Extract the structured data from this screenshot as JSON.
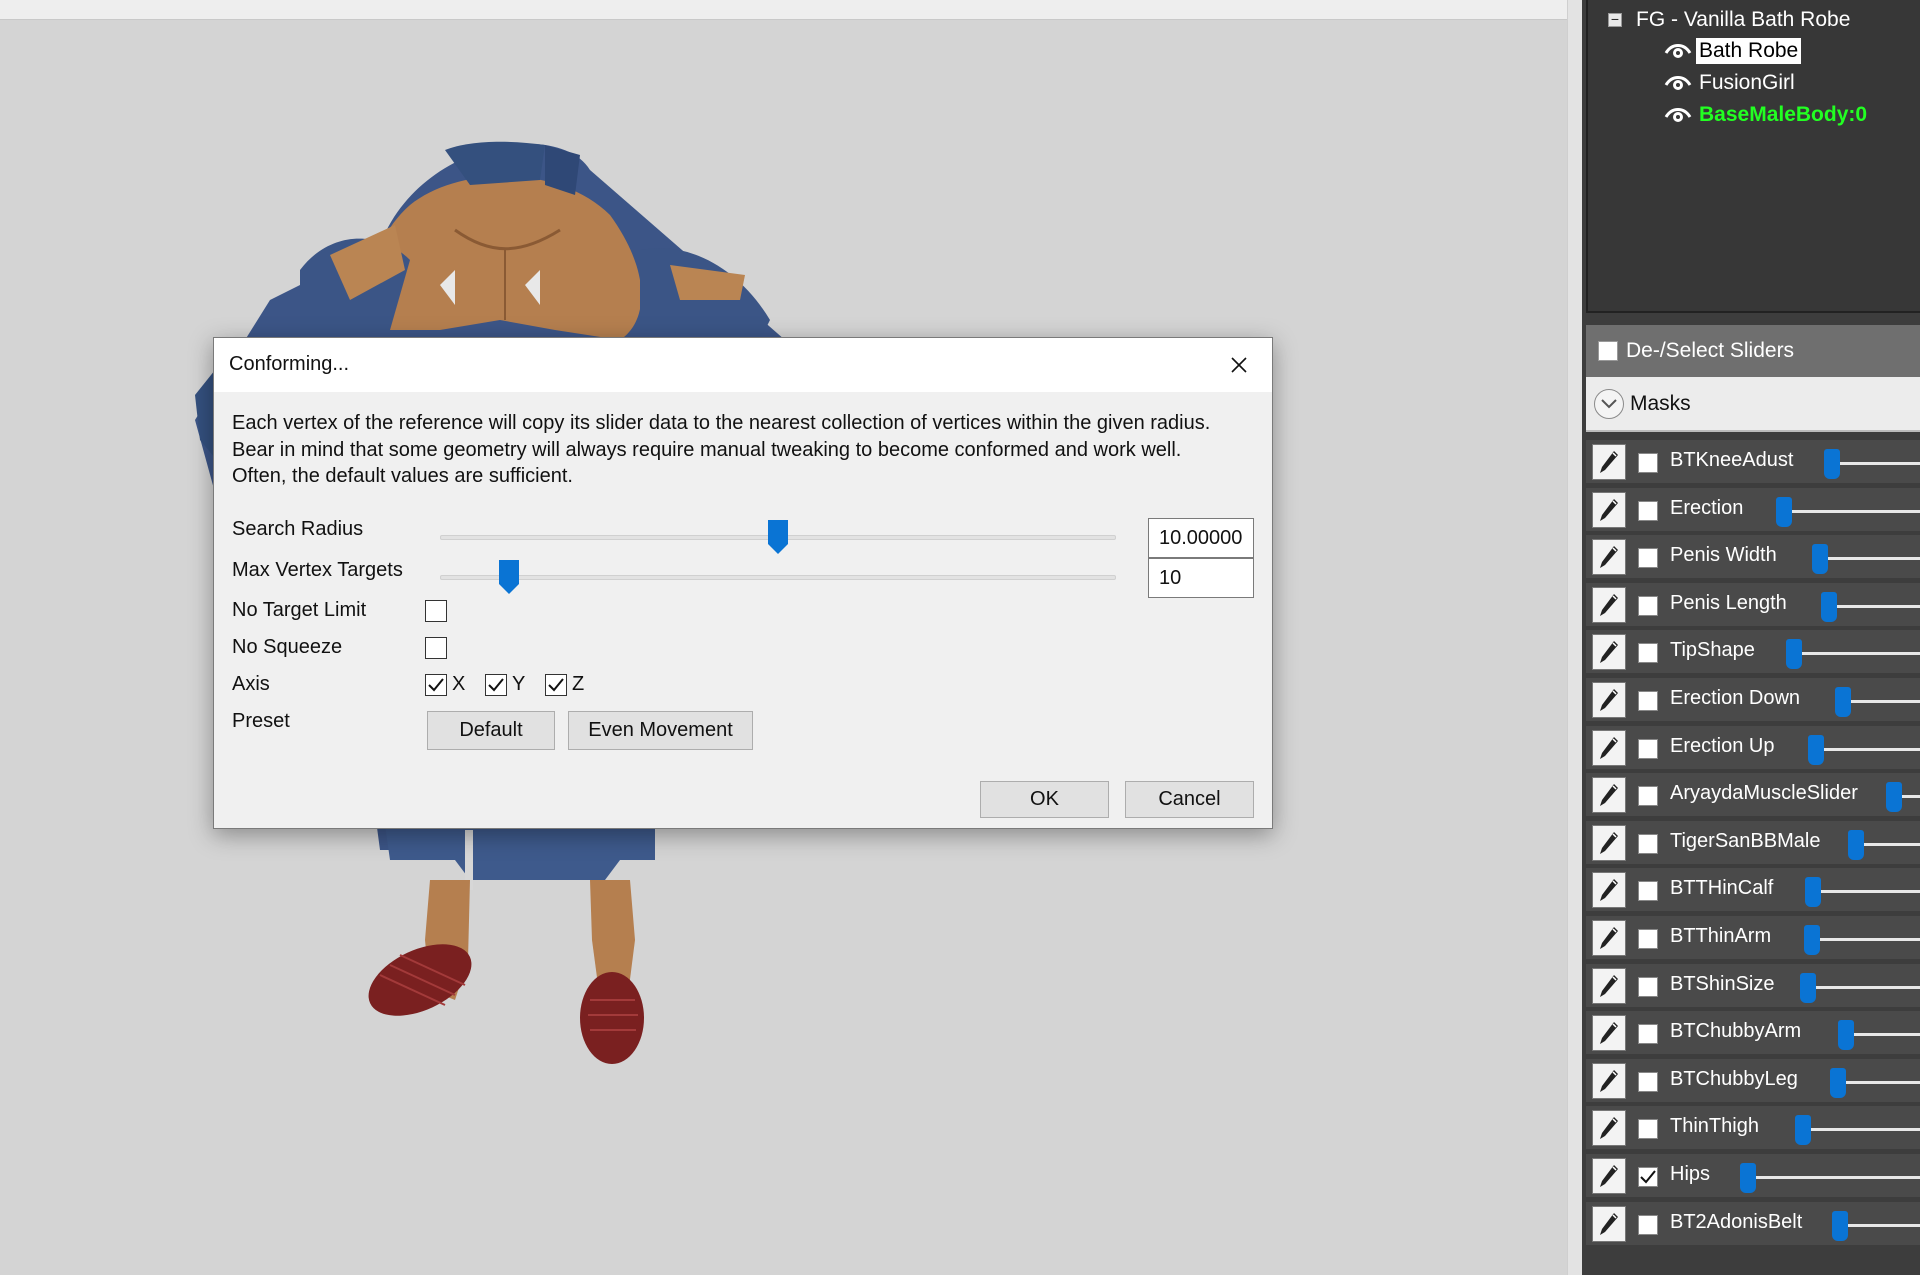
{
  "tree": {
    "root_label": "FG - Vanilla Bath Robe",
    "collapse_glyph": "−",
    "items": [
      {
        "label": "Bath Robe",
        "icon": "eye-icon",
        "selected": true
      },
      {
        "label": "FusionGirl",
        "icon": "eye-icon",
        "selected": false
      },
      {
        "label": "BaseMaleBody:0",
        "icon": "eye-icon",
        "selected": false,
        "color": "#22ff22"
      }
    ]
  },
  "sliders_panel": {
    "deselect_label": "De-/Select Sliders",
    "masks_label": "Masks",
    "accent_color": "#0a74d4",
    "rows": [
      {
        "label": "BTKneeAdust",
        "checked": false
      },
      {
        "label": "Erection",
        "checked": false
      },
      {
        "label": "Penis Width",
        "checked": false
      },
      {
        "label": "Penis Length",
        "checked": false
      },
      {
        "label": "TipShape",
        "checked": false
      },
      {
        "label": "Erection Down",
        "checked": false
      },
      {
        "label": "Erection Up",
        "checked": false
      },
      {
        "label": "AryaydaMuscleSlider",
        "checked": false
      },
      {
        "label": "TigerSanBBMale",
        "checked": false
      },
      {
        "label": "BTTHinCalf",
        "checked": false
      },
      {
        "label": "BTThinArm",
        "checked": false
      },
      {
        "label": "BTShinSize",
        "checked": false
      },
      {
        "label": "BTChubbyArm",
        "checked": false
      },
      {
        "label": "BTChubbyLeg",
        "checked": false
      },
      {
        "label": "ThinThigh",
        "checked": false
      },
      {
        "label": "Hips",
        "checked": true
      },
      {
        "label": "BT2AdonisBelt",
        "checked": false
      }
    ]
  },
  "dialog": {
    "title": "Conforming...",
    "close_glyph": "✕",
    "description": "Each vertex of the reference will copy its slider data to the nearest collection of vertices within the given radius. Bear in mind that some geometry will always require manual tweaking to become conformed and work well. Often, the default values are sufficient.",
    "search_radius": {
      "label": "Search Radius",
      "value": "10.00000"
    },
    "max_vertex_targets": {
      "label": "Max Vertex Targets",
      "value": "10"
    },
    "no_target_limit": {
      "label": "No Target Limit",
      "checked": false
    },
    "no_squeeze": {
      "label": "No Squeeze",
      "checked": false
    },
    "axis": {
      "label": "Axis",
      "x": "X",
      "y": "Y",
      "z": "Z",
      "checked": [
        true,
        true,
        true
      ]
    },
    "preset": {
      "label": "Preset",
      "default_btn": "Default",
      "even_btn": "Even Movement"
    },
    "ok_label": "OK",
    "cancel_label": "Cancel"
  }
}
